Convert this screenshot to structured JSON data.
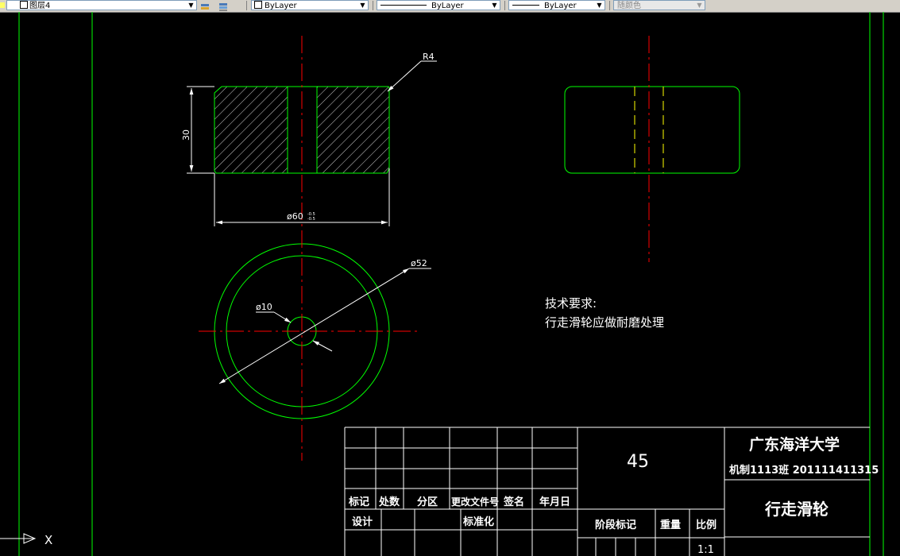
{
  "toolbar": {
    "layer_name": "图层4",
    "color_value": "ByLayer",
    "linetype_value": "ByLayer",
    "lineweight_value": "ByLayer",
    "plotstyle_value": "随颜色"
  },
  "drawing": {
    "dim_radius": "R4",
    "dim_height": "30",
    "dim_outer_diameter": "ø60",
    "dim_tol_upper": "-0.5",
    "dim_tol_lower": "-0.5",
    "dim_diameter_52": "ø52",
    "dim_diameter_10": "ø10",
    "tech_req_title": "技术要求:",
    "tech_req_text": "行走滑轮应做耐磨处理",
    "ucs_label": "X"
  },
  "title_block": {
    "material": "45",
    "university": "广东海洋大学",
    "class_info": "机制1113班 201111411315",
    "part_name": "行走滑轮",
    "headers": [
      "标记",
      "处数",
      "分区",
      "更改文件号",
      "签名",
      "年月日"
    ],
    "design_label": "设计",
    "standard_label": "标准化",
    "stage_label": "阶段标记",
    "weight_label": "重量",
    "scale_label": "比例",
    "scale_value": "1:1"
  },
  "colors": {
    "frame": "#00ff00",
    "center_line": "#ff0000",
    "object_line": "#00ff00",
    "dimension": "#ffffff",
    "background": "#000000",
    "hidden_line": "#ffff00"
  }
}
